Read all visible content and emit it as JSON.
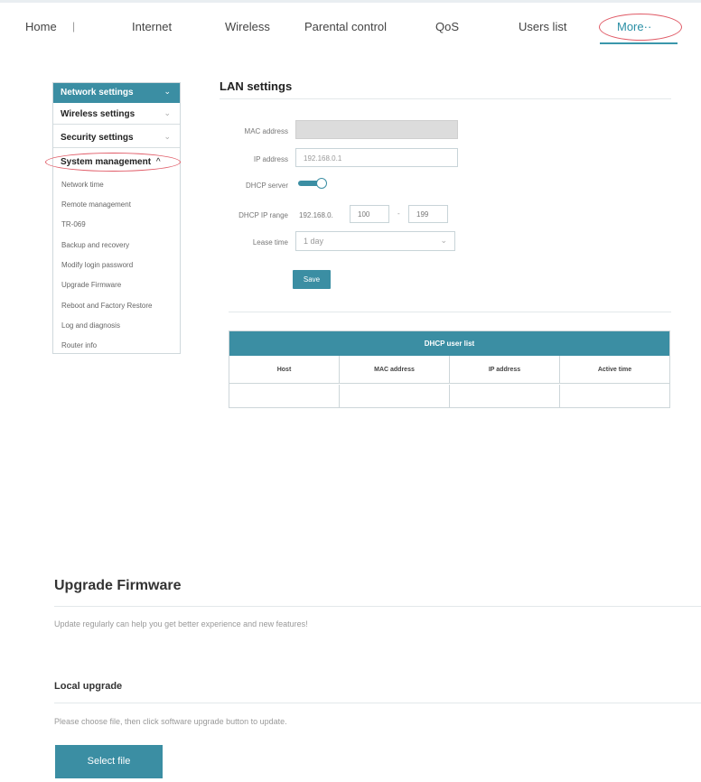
{
  "nav": {
    "home": "Home",
    "separator": "|",
    "internet": "Internet",
    "wireless": "Wireless",
    "parental": "Parental control",
    "qos": "QoS",
    "users": "Users list",
    "more": "More··"
  },
  "sidebar": {
    "network": "Network settings",
    "wireless": "Wireless settings",
    "security": "Security settings",
    "system": "System management",
    "expand_chevron": "⌄",
    "collapse_chevron": "^",
    "sub_items": [
      "Network time",
      "Remote management",
      "TR-069",
      "Backup and recovery",
      "Modify login password",
      "Upgrade Firmware",
      "Reboot and Factory Restore",
      "Log and diagnosis",
      "Router info"
    ]
  },
  "lan": {
    "title": "LAN settings",
    "mac_label": "MAC address",
    "ip_label": "IP address",
    "ip_value": "192.168.0.1",
    "dhcp_label": "DHCP server",
    "dhcp_enabled": true,
    "range_label": "DHCP IP range",
    "range_prefix": "192.168.0.",
    "range_start": "100",
    "range_dash": "-",
    "range_end": "199",
    "lease_label": "Lease time",
    "lease_value": "1 day",
    "save": "Save"
  },
  "dhcp": {
    "title": "DHCP user list",
    "columns": [
      "Host",
      "MAC address",
      "IP address",
      "Active time"
    ]
  },
  "firmware": {
    "title": "Upgrade Firmware",
    "description": "Update regularly can help you get better experience and new features!",
    "local_title": "Local upgrade",
    "local_description": "Please choose file, then click software upgrade button to update.",
    "select_file": "Select file"
  },
  "colors": {
    "accent": "#3b8ea3",
    "highlight_circle": "#e05a66"
  }
}
